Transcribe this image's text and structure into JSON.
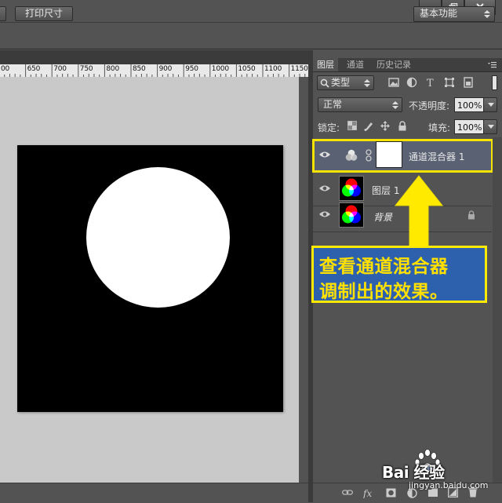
{
  "window": {
    "minimize_icon": "minimize-icon",
    "restore_icon": "restore-icon",
    "close_icon": "close-icon"
  },
  "options_bar": {
    "print_size_label": "打印尺寸",
    "workspace_label": "基本功能"
  },
  "ruler": {
    "ticks": [
      "00",
      "650",
      "700",
      "750",
      "800",
      "850",
      "900",
      "950",
      "1000",
      "1050",
      "1100",
      "1150"
    ]
  },
  "layers_panel": {
    "tabs": [
      "图层",
      "通道",
      "历史记录"
    ],
    "kind_filter": "类型",
    "blend_mode": "正常",
    "opacity_label": "不透明度:",
    "opacity_value": "100%",
    "lock_label": "锁定:",
    "fill_label": "填充:",
    "fill_value": "100%",
    "layers": [
      {
        "name": "通道混合器 1",
        "type": "channel-mixer-adjustment",
        "visible": true,
        "selected": true
      },
      {
        "name": "图层 1",
        "type": "pixel",
        "visible": true,
        "selected": false
      },
      {
        "name": "背景",
        "type": "background",
        "visible": true,
        "locked": true,
        "selected": false
      }
    ]
  },
  "annotation": {
    "line1": "查看通道混合器",
    "line2": "调制出的效果。",
    "highlight_color": "#ffea00",
    "box_color": "#2d60ad"
  },
  "watermark": {
    "brand": "Bai 经验",
    "url": "jingyan.baidu.com"
  },
  "colors": {
    "ui_background": "#535353",
    "canvas_background": "#c9c9c9",
    "document_fill": "#000000",
    "shape_fill": "#ffffff",
    "selected_layer": "#596173"
  }
}
